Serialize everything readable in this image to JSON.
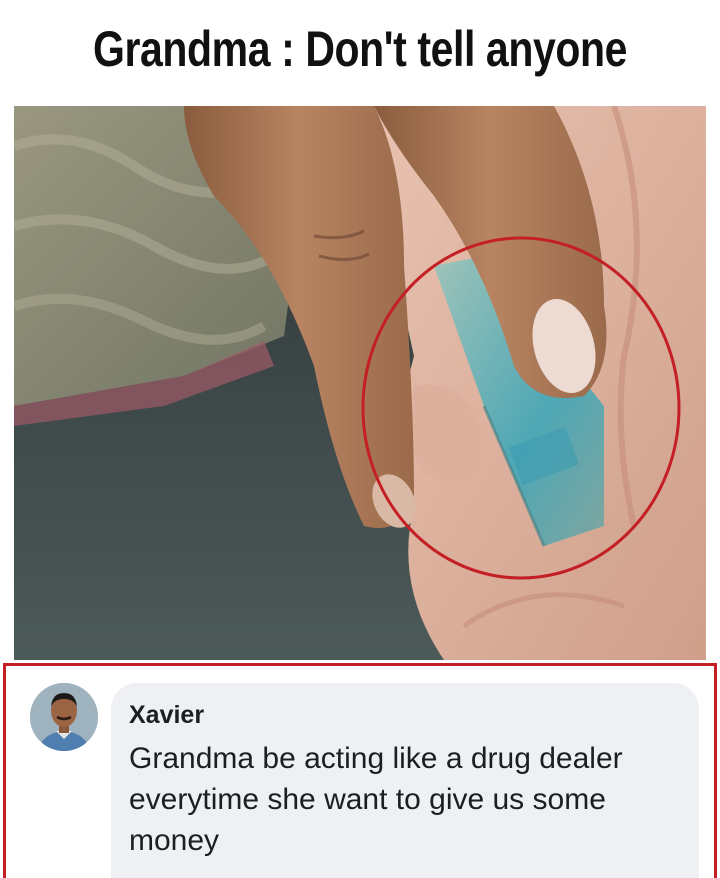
{
  "meme": {
    "caption": "Grandma : Don't tell anyone"
  },
  "photo": {
    "highlight_color": "#c41f24"
  },
  "comment": {
    "author": "Xavier",
    "text": "Grandma be acting like a drug dealer everytime she want to give us some money",
    "highlight_border_color": "#c41f24"
  }
}
